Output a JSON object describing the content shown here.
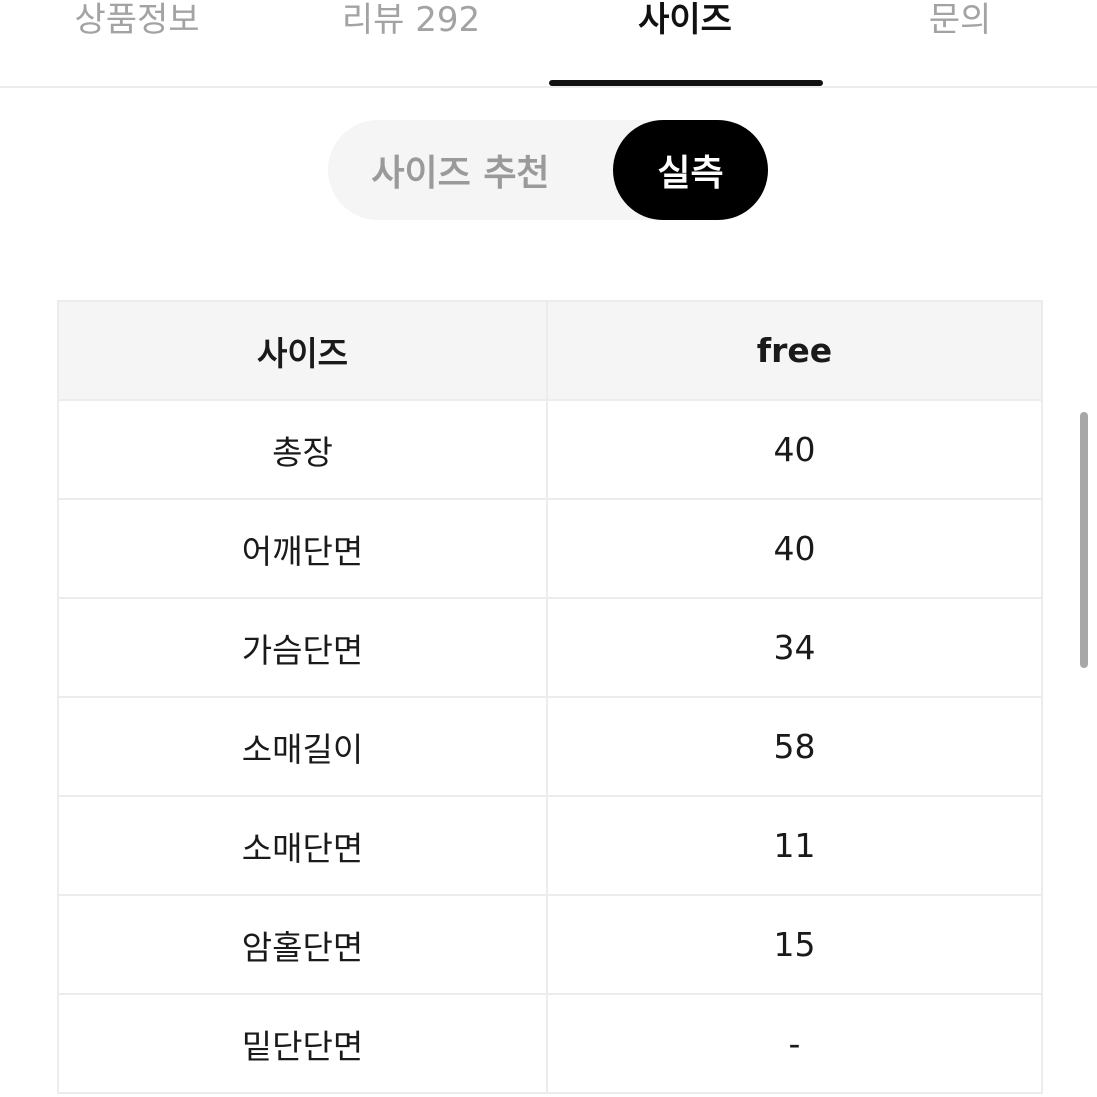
{
  "tabs": [
    {
      "label": "상품정보",
      "active": false
    },
    {
      "label": "리뷰 292",
      "active": false
    },
    {
      "label": "사이즈",
      "active": true
    },
    {
      "label": "문의",
      "active": false
    }
  ],
  "size_toggle": {
    "options": [
      {
        "label": "사이즈 추천",
        "selected": false
      },
      {
        "label": "실측",
        "selected": true
      }
    ]
  },
  "size_table": {
    "headers": [
      "사이즈",
      "free"
    ],
    "rows": [
      {
        "label": "총장",
        "value": "40"
      },
      {
        "label": "어깨단면",
        "value": "40"
      },
      {
        "label": "가슴단면",
        "value": "34"
      },
      {
        "label": "소매길이",
        "value": "58"
      },
      {
        "label": "소매단면",
        "value": "11"
      },
      {
        "label": "암홀단면",
        "value": "15"
      },
      {
        "label": "밑단단면",
        "value": "-"
      }
    ]
  },
  "colors": {
    "active_text": "#111111",
    "inactive_text": "#a3a3a3",
    "toggle_bg": "#f5f5f5",
    "toggle_selected_bg": "#000000",
    "table_header_bg": "#f5f5f5",
    "border": "#ececec"
  }
}
